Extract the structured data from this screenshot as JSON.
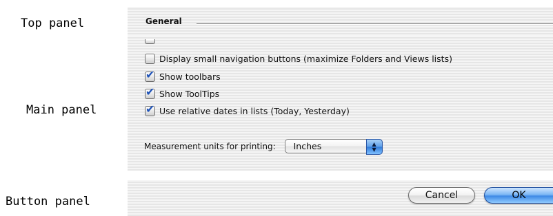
{
  "annotations": {
    "top_panel": "Top panel",
    "main_panel": "Main panel",
    "button_panel": "Button panel"
  },
  "top_panel": {
    "section_title": "General"
  },
  "main_panel": {
    "checkboxes": [
      {
        "label": "",
        "checked": false
      },
      {
        "label": "Display small navigation buttons (maximize Folders and Views lists)",
        "checked": false
      },
      {
        "label": "Show toolbars",
        "checked": true
      },
      {
        "label": "Show ToolTips",
        "checked": true
      },
      {
        "label": "Use relative dates in lists (Today, Yesterday)",
        "checked": true
      }
    ],
    "units": {
      "label": "Measurement units for printing:",
      "value": "Inches"
    }
  },
  "button_panel": {
    "cancel_label": "Cancel",
    "ok_label": "OK"
  },
  "icons": {
    "checkmark": "✔",
    "popup_arrows": "up-down-arrows"
  },
  "colors": {
    "accent": "#3f8ae6",
    "check": "#1f53b8"
  }
}
